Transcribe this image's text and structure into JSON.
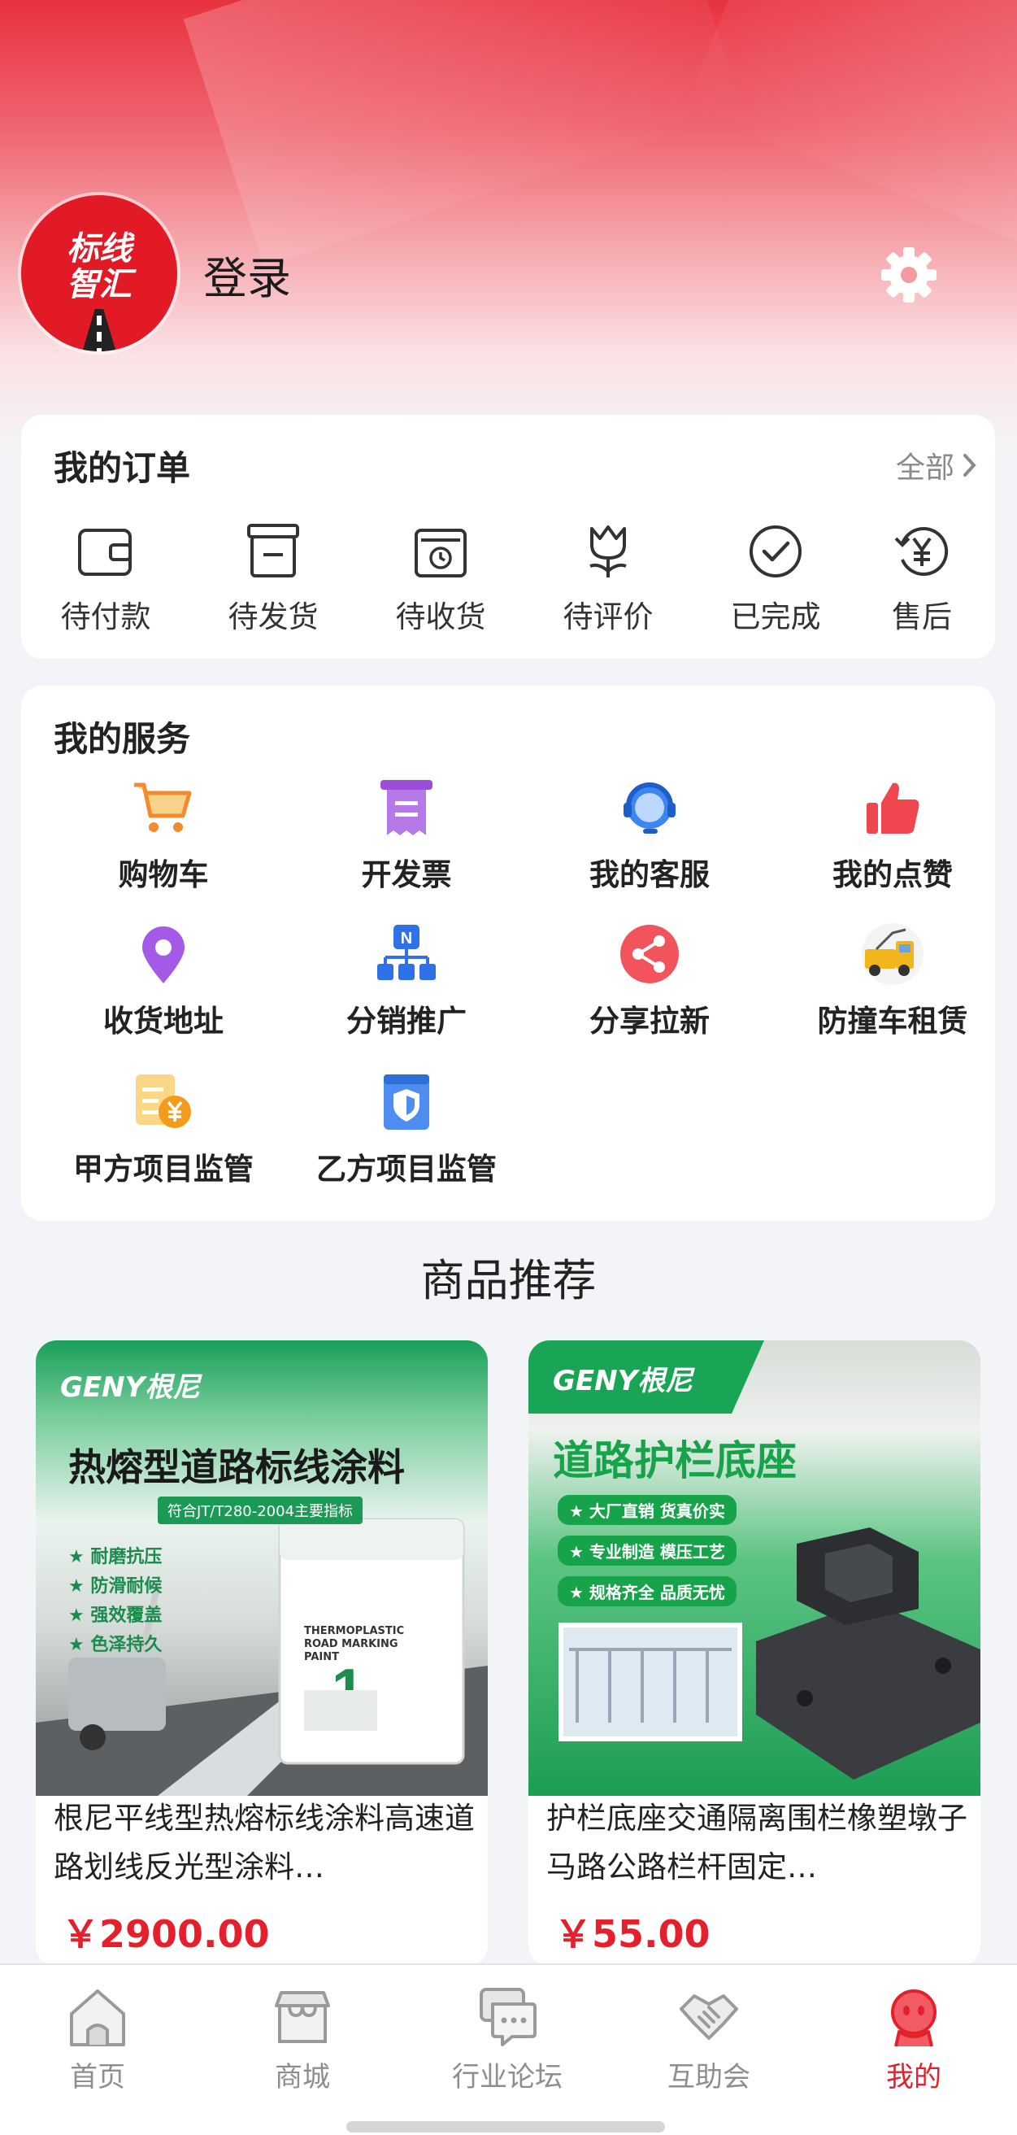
{
  "header": {
    "logo_line1": "标线",
    "logo_line2": "智汇",
    "login_label": "登录"
  },
  "orders": {
    "title": "我的订单",
    "all_label": "全部",
    "items": [
      {
        "label": "待付款",
        "icon": "wallet-icon"
      },
      {
        "label": "待发货",
        "icon": "package-icon"
      },
      {
        "label": "待收货",
        "icon": "delivery-box-icon"
      },
      {
        "label": "待评价",
        "icon": "tulip-icon"
      },
      {
        "label": "已完成",
        "icon": "check-circle-icon"
      },
      {
        "label": "售后",
        "icon": "refund-yen-icon"
      }
    ]
  },
  "services": {
    "title": "我的服务",
    "items": [
      {
        "label": "购物车",
        "icon": "shopping-cart-icon"
      },
      {
        "label": "开发票",
        "icon": "invoice-icon"
      },
      {
        "label": "我的客服",
        "icon": "customer-service-icon"
      },
      {
        "label": "我的点赞",
        "icon": "thumbs-up-icon"
      },
      {
        "label": "收货地址",
        "icon": "location-pin-icon"
      },
      {
        "label": "分销推广",
        "icon": "distribution-network-icon"
      },
      {
        "label": "分享拉新",
        "icon": "share-icon"
      },
      {
        "label": "防撞车租赁",
        "icon": "crash-truck-icon"
      },
      {
        "label": "甲方项目监管",
        "icon": "party-a-yen-doc-icon"
      },
      {
        "label": "乙方项目监管",
        "icon": "party-b-shield-doc-icon"
      }
    ]
  },
  "recommend": {
    "title": "商品推荐",
    "products": [
      {
        "name": "根尼平线型热熔标线涂料高速道路划线反光型涂料…",
        "price": "￥2900.00",
        "image": {
          "brand": "GENY根尼",
          "headline": "热熔型道路标线涂料",
          "subtitle": "符合JT/T280-2004主要指标",
          "features": [
            "★ 耐磨抗压",
            "★ 防滑耐候",
            "★ 强效覆盖",
            "★ 色泽持久"
          ],
          "bag_text": "THERMOPLASTIC ROAD MARKING PAINT",
          "bag_number": "1"
        }
      },
      {
        "name": "护栏底座交通隔离围栏橡塑墩子马路公路栏杆固定…",
        "price": "￥55.00",
        "image": {
          "brand": "GENY根尼",
          "headline": "道路护栏底座",
          "features": [
            "★ 大厂直销 货真价实",
            "★ 专业制造 模压工艺",
            "★ 规格齐全 品质无忧"
          ]
        }
      }
    ]
  },
  "tabbar": {
    "active_color": "#e3202b",
    "items": [
      {
        "label": "首页",
        "icon": "home-icon"
      },
      {
        "label": "商城",
        "icon": "store-icon"
      },
      {
        "label": "行业论坛",
        "icon": "forum-chat-icon"
      },
      {
        "label": "互助会",
        "icon": "handshake-icon"
      },
      {
        "label": "我的",
        "icon": "profile-icon",
        "active": true
      }
    ]
  }
}
